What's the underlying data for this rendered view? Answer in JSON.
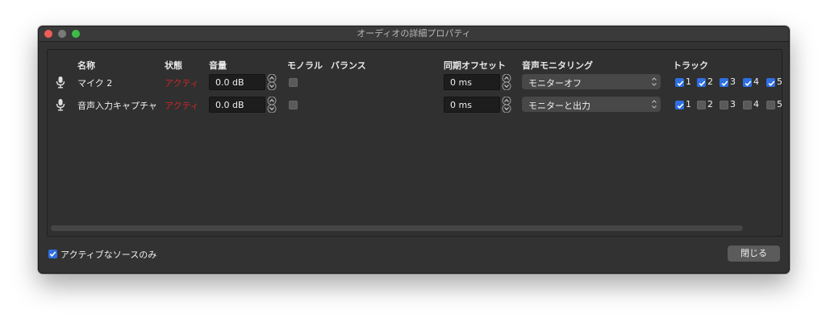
{
  "window": {
    "title": "オーディオの詳細プロパティ"
  },
  "columns": {
    "name": "名称",
    "status": "状態",
    "volume": "音量",
    "mono": "モノラル",
    "balance": "バランス",
    "sync_offset": "同期オフセット",
    "monitoring": "音声モニタリング",
    "tracks": "トラック"
  },
  "rows": [
    {
      "name": "マイク 2",
      "status": "アクティ",
      "volume": "0.0 dB",
      "mono": false,
      "sync_offset": "0 ms",
      "monitoring": "モニターオフ",
      "tracks": [
        {
          "label": "1",
          "checked": true
        },
        {
          "label": "2",
          "checked": true
        },
        {
          "label": "3",
          "checked": true
        },
        {
          "label": "4",
          "checked": true
        },
        {
          "label": "5",
          "checked": true
        }
      ]
    },
    {
      "name": "音声入力キャプチャ",
      "status": "アクティ",
      "volume": "0.0 dB",
      "mono": false,
      "sync_offset": "0 ms",
      "monitoring": "モニターと出力",
      "tracks": [
        {
          "label": "1",
          "checked": true
        },
        {
          "label": "2",
          "checked": false
        },
        {
          "label": "3",
          "checked": false
        },
        {
          "label": "4",
          "checked": false
        },
        {
          "label": "5",
          "checked": false
        }
      ]
    }
  ],
  "footer": {
    "active_only_label": "アクティブなソースのみ",
    "active_only_checked": true,
    "close_label": "閉じる"
  },
  "icons": {
    "row_icon": "microphone-icon"
  },
  "colors": {
    "status_color": "#c62828",
    "checkbox_accent": "#2f6fe0"
  }
}
